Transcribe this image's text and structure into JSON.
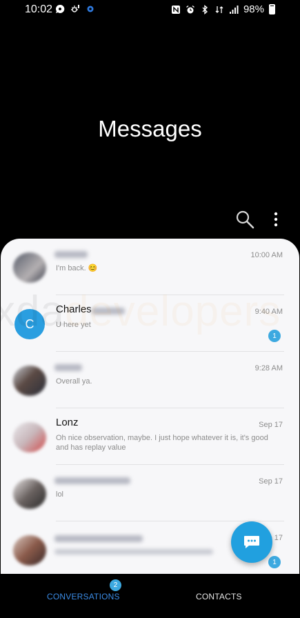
{
  "status_bar": {
    "time": "10:02",
    "battery": "98%",
    "left_icons": [
      "chat-bubble-icon",
      "sun-alert-icon",
      "gear-icon"
    ],
    "right_icons": [
      "nfc-icon",
      "alarm-icon",
      "bluetooth-icon",
      "data-icon",
      "signal-icon",
      "battery-icon"
    ]
  },
  "header": {
    "title": "Messages"
  },
  "conversations": [
    {
      "name": "",
      "preview": "I'm back. 😊",
      "time": "10:00 AM",
      "unread": ""
    },
    {
      "name": "Charles",
      "avatar_letter": "C",
      "preview": "U here yet",
      "time": "9:40 AM",
      "unread": "1"
    },
    {
      "name": "",
      "preview": "Overall ya.",
      "time": "9:28 AM",
      "unread": ""
    },
    {
      "name": "Lonz",
      "preview": "Oh nice observation, maybe. I just hope whatever it is, it's good and has replay value",
      "time": "Sep 17",
      "unread": ""
    },
    {
      "name": "",
      "preview": "lol",
      "time": "Sep 17",
      "unread": ""
    },
    {
      "name": "",
      "preview": "",
      "time": "Sep 17",
      "unread": "1"
    }
  ],
  "watermark": {
    "part1": "xda",
    "part2": "developers"
  },
  "tabs": {
    "conversations": "CONVERSATIONS",
    "conversations_badge": "2",
    "contacts": "CONTACTS"
  },
  "colors": {
    "accent": "#21a0df",
    "badge": "#3da9e0",
    "active_tab": "#3b8ce6"
  }
}
